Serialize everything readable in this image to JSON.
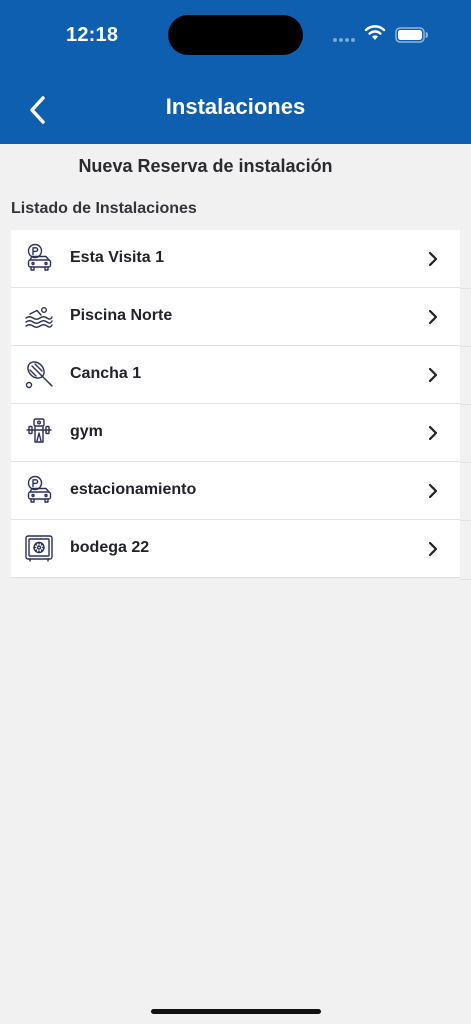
{
  "status_bar": {
    "time": "12:18"
  },
  "nav": {
    "title": "Instalaciones",
    "back_icon": "chevron-left-icon"
  },
  "new_reservation_label": "Nueva Reserva de instalación",
  "section_title": "Listado de Instalaciones",
  "facilities": [
    {
      "label": "Esta Visita 1",
      "icon": "parking-car-icon"
    },
    {
      "label": "Piscina Norte",
      "icon": "swimming-icon"
    },
    {
      "label": "Cancha 1",
      "icon": "tennis-racket-icon"
    },
    {
      "label": "gym",
      "icon": "dumbbell-icon"
    },
    {
      "label": "estacionamiento",
      "icon": "parking-car-icon"
    },
    {
      "label": "bodega 22",
      "icon": "safe-icon"
    }
  ],
  "colors": {
    "header": "#0f5fb0",
    "background": "#f1f1f2",
    "icon": "#2c3157"
  }
}
